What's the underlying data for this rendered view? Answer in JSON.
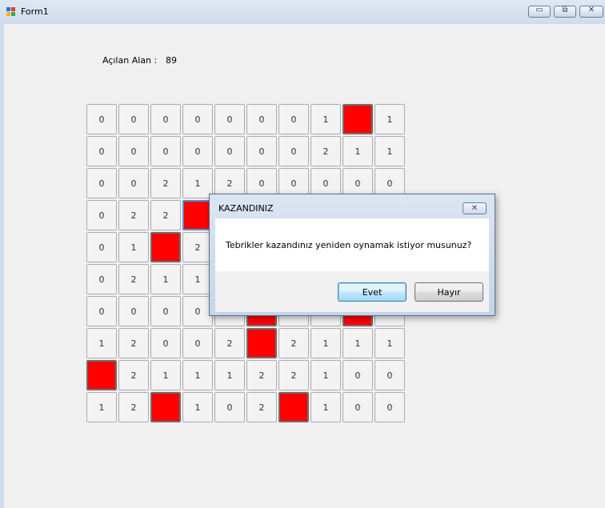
{
  "window": {
    "title": "Form1",
    "minimize_glyph": "▭",
    "maximize_glyph": "⧉",
    "close_glyph": "✕"
  },
  "stats": {
    "opened_label": "Açılan Alan :",
    "opened_value": "89"
  },
  "board": {
    "rows": [
      [
        "0",
        "0",
        "0",
        "0",
        "0",
        "0",
        "0",
        "1",
        "M",
        "1"
      ],
      [
        "0",
        "0",
        "0",
        "0",
        "0",
        "0",
        "0",
        "2",
        "1",
        "1"
      ],
      [
        "0",
        "0",
        "2",
        "1",
        "2",
        "0",
        "0",
        "0",
        "0",
        "0"
      ],
      [
        "0",
        "2",
        "2",
        "M",
        "",
        "",
        "",
        "",
        "",
        ""
      ],
      [
        "0",
        "1",
        "M",
        "2",
        "",
        "",
        "",
        "",
        "",
        ""
      ],
      [
        "0",
        "2",
        "1",
        "1",
        "",
        "",
        "",
        "",
        "",
        ""
      ],
      [
        "0",
        "0",
        "0",
        "0",
        "",
        "M",
        "",
        "",
        "M",
        ""
      ],
      [
        "1",
        "2",
        "0",
        "0",
        "2",
        "M",
        "2",
        "1",
        "1",
        "1"
      ],
      [
        "M",
        "2",
        "1",
        "1",
        "1",
        "2",
        "2",
        "1",
        "0",
        "0"
      ],
      [
        "1",
        "2",
        "M",
        "1",
        "0",
        "2",
        "M",
        "1",
        "0",
        "0"
      ]
    ],
    "mine_color": "#ff0000"
  },
  "dialog": {
    "title": "KAZANDINIZ",
    "close_glyph": "✕",
    "message": "Tebrikler kazandınız yeniden oynamak istiyor musunuz?",
    "yes_label": "Evet",
    "no_label": "Hayır"
  }
}
